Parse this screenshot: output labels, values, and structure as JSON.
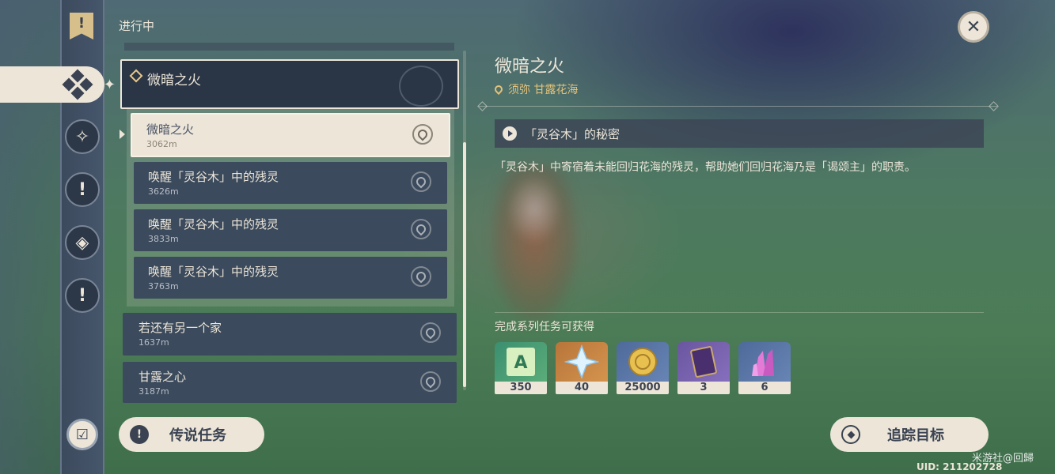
{
  "header": {
    "section_label": "进行中"
  },
  "series": {
    "title": "微暗之火"
  },
  "quests": [
    {
      "name": "微暗之火",
      "distance": "3062m",
      "selected": true
    },
    {
      "name": "唤醒「灵谷木」中的残灵",
      "distance": "3626m"
    },
    {
      "name": "唤醒「灵谷木」中的残灵",
      "distance": "3833m"
    },
    {
      "name": "唤醒「灵谷木」中的残灵",
      "distance": "3763m"
    },
    {
      "name": "若还有另一个家",
      "distance": "1637m"
    },
    {
      "name": "甘露之心",
      "distance": "3187m"
    }
  ],
  "buttons": {
    "legend_quests": "传说任务",
    "track": "追踪目标"
  },
  "detail": {
    "title": "微暗之火",
    "location": "须弥 甘露花海",
    "subquest": "「灵谷木」的秘密",
    "description": "「灵谷木」中寄宿着未能回归花海的残灵，帮助她们回归花海乃是「谒颂主」的职责。",
    "reward_label": "完成系列任务可获得"
  },
  "rewards": [
    {
      "icon": "adventure-exp-icon",
      "count": "350"
    },
    {
      "icon": "primogem-icon",
      "count": "40"
    },
    {
      "icon": "mora-icon",
      "count": "25000"
    },
    {
      "icon": "heros-wit-book-icon",
      "count": "3"
    },
    {
      "icon": "mystic-ore-icon",
      "count": "6"
    }
  ],
  "footer": {
    "uid": "UID: 211202728",
    "watermark": "米游社@回歸"
  },
  "colors": {
    "panel_light": "#ece5d8",
    "panel_dark": "#3b4a5c",
    "accent_gold": "#e3c27a"
  }
}
